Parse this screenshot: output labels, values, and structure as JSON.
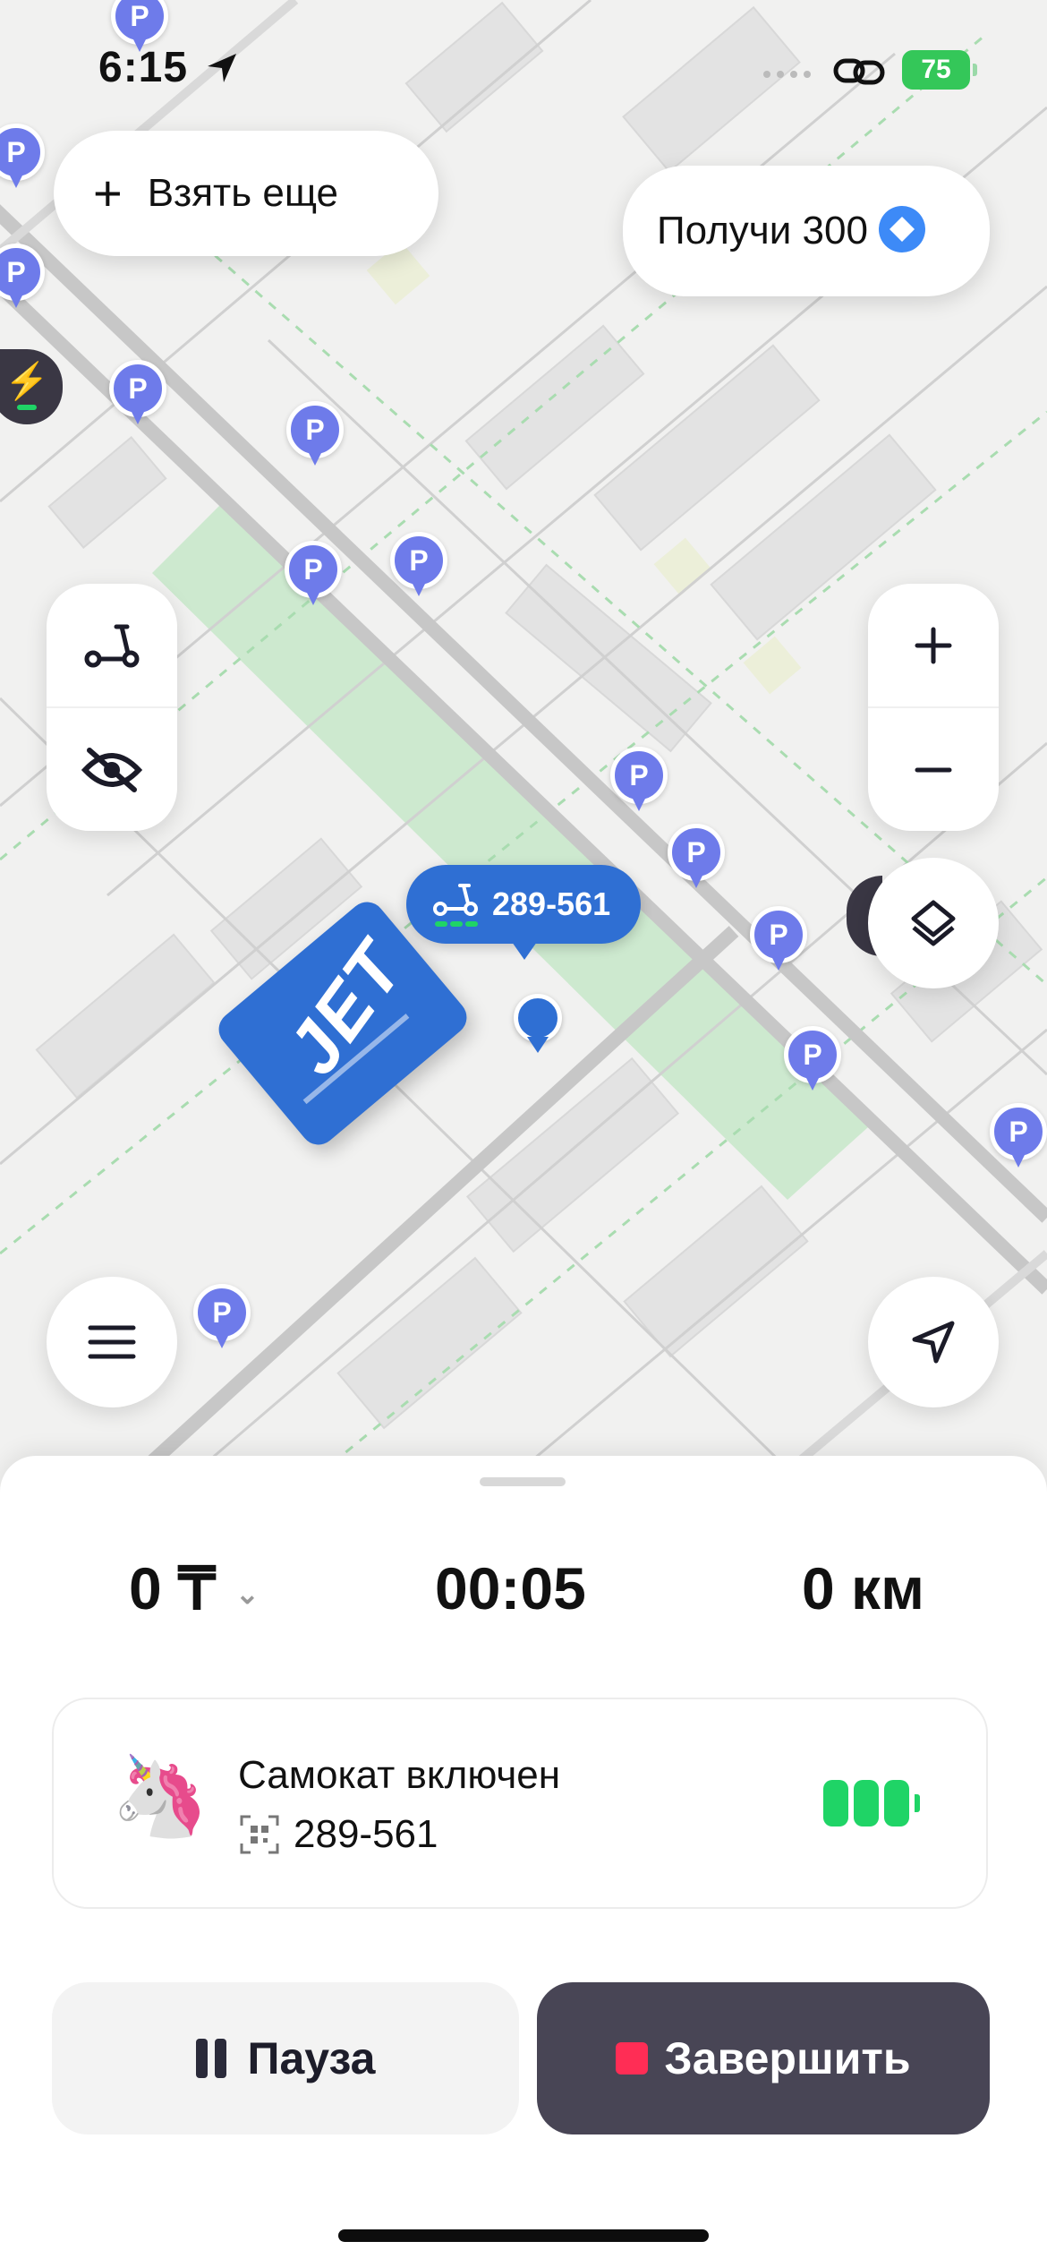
{
  "status_bar": {
    "time": "6:15",
    "battery": "75"
  },
  "map": {
    "take_more_label": "Взять еще",
    "promo_label": "Получи 300",
    "scooter_tag_number": "289-561",
    "brand_logo_text": "JET",
    "parking_marker_letter": "P",
    "colors": {
      "parking": "#6e7bea",
      "park_green": "#cde9cf",
      "tag_blue": "#2f6fd3"
    }
  },
  "ride": {
    "cost": "0 ₸",
    "duration": "00:05",
    "distance": "0 км",
    "vehicle_status": "Самокат включен",
    "vehicle_id": "289-561",
    "vehicle_battery_cells": 3,
    "pause_label": "Пауза",
    "finish_label": "Завершить",
    "colors": {
      "finish_bg": "#484555",
      "stop_square": "#ff2d55",
      "battery_green": "#1fd466"
    }
  }
}
